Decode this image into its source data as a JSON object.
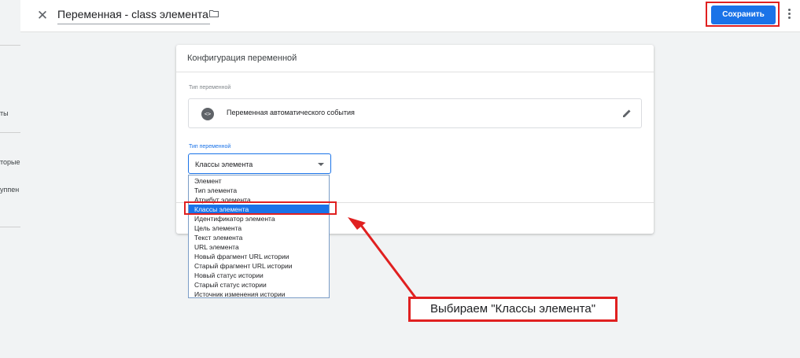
{
  "background_page": {
    "fragments": [
      "ты",
      "торые с",
      "уппен"
    ]
  },
  "toolbar": {
    "title": "Переменная - class элемента",
    "save_label": "Сохранить"
  },
  "card": {
    "title": "Конфигурация переменной",
    "variable_type_label": "Тип переменной",
    "variable_type_name": "Переменная автоматического события",
    "variable_type_icon": "<>",
    "select_label": "Тип переменной",
    "select_value": "Классы элемента"
  },
  "dropdown": {
    "options": [
      "Элемент",
      "Тип элемента",
      "Атрибут элемента",
      "Классы элемента",
      "Идентификатор элемента",
      "Цель элемента",
      "Текст элемента",
      "URL элемента",
      "Новый фрагмент URL истории",
      "Старый фрагмент URL истории",
      "Новый статус истории",
      "Старый статус истории",
      "Источник изменения истории"
    ],
    "selected_index": 3
  },
  "annotation": {
    "callout_text": "Выбираем \"Классы элемента\""
  },
  "colors": {
    "accent": "#1a73e8",
    "annotation_red": "#e02020"
  }
}
